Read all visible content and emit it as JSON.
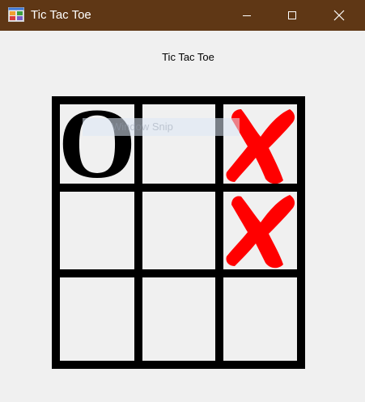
{
  "window": {
    "title": "Tic Tac Toe",
    "titlebar_color": "#5f3715",
    "icon": "app-form-icon",
    "controls": {
      "minimize_icon": "minimize-icon",
      "maximize_icon": "maximize-icon",
      "close_icon": "close-icon"
    }
  },
  "main": {
    "heading": "Tic Tac Toe"
  },
  "board": {
    "line_color": "#000000",
    "x_color": "#ff0000",
    "o_color": "#000000",
    "cells": [
      [
        "O",
        "",
        "X"
      ],
      [
        "",
        "",
        "X"
      ],
      [
        "",
        "",
        ""
      ]
    ]
  },
  "overlay": {
    "text": "Window Snip"
  }
}
